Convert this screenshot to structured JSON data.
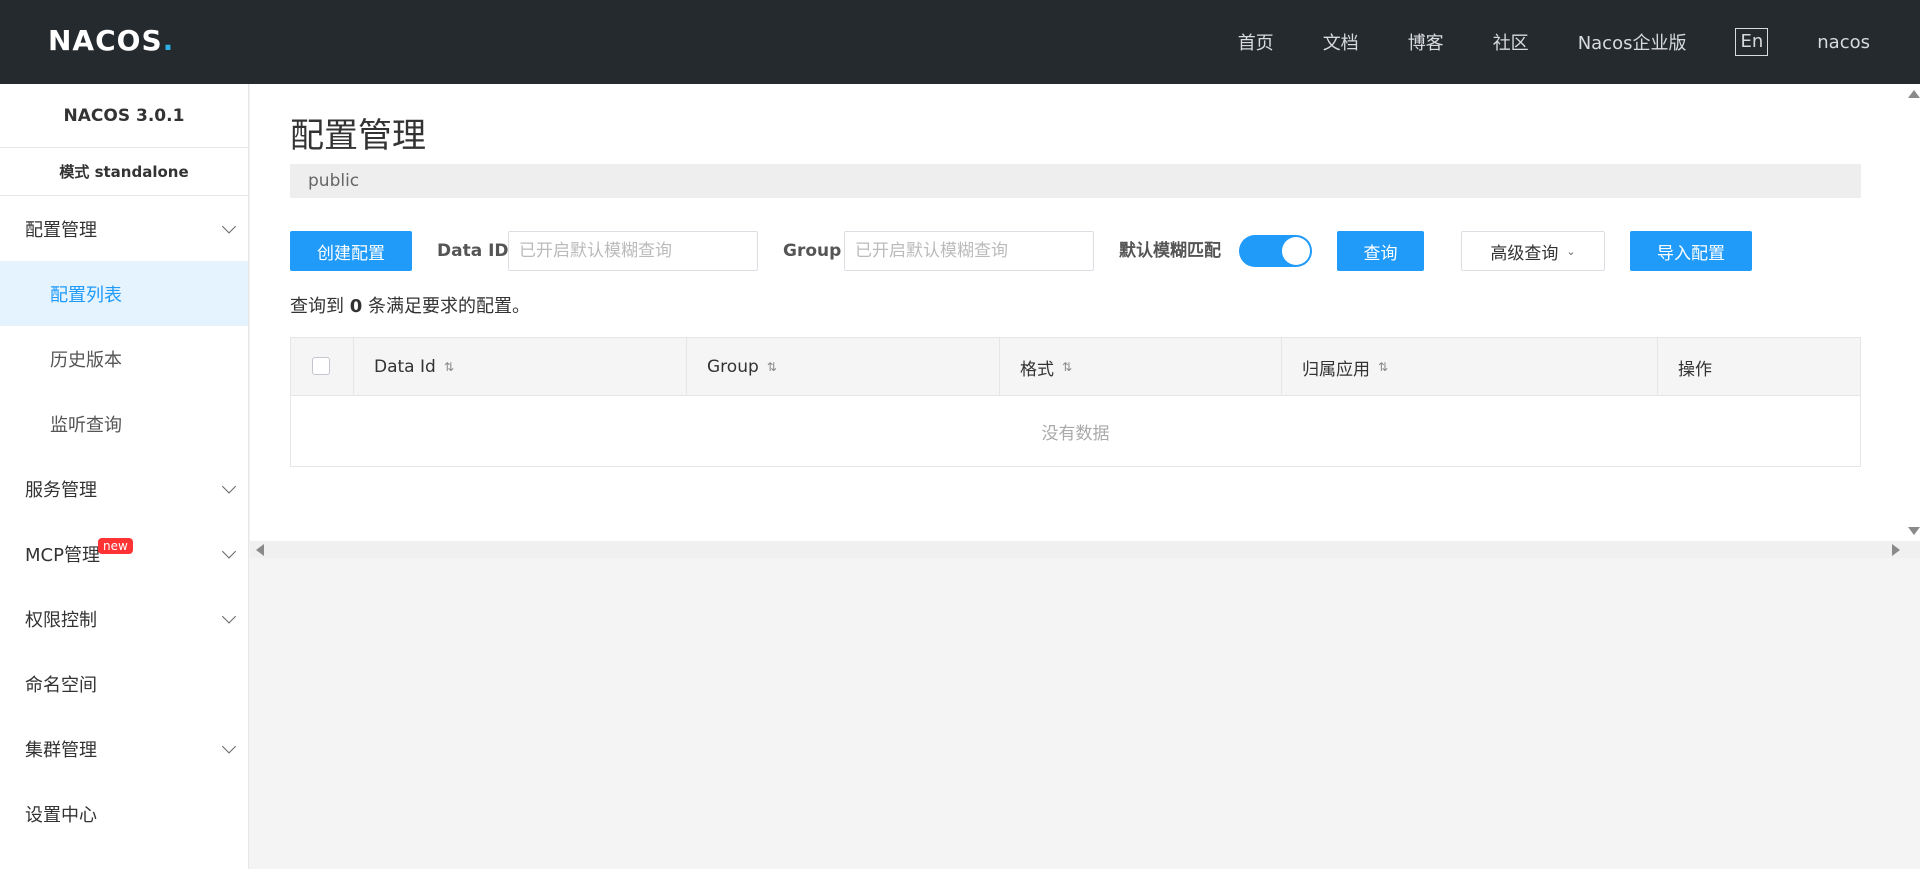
{
  "brand": {
    "logo_text": "NACOS",
    "logo_dot": "."
  },
  "topnav": {
    "items": [
      "首页",
      "文档",
      "博客",
      "社区",
      "Nacos企业版"
    ],
    "lang": "En",
    "user": "nacos"
  },
  "sidebar": {
    "version": "NACOS 3.0.1",
    "mode": "模式 standalone",
    "menu": [
      {
        "label": "配置管理",
        "expandable": true
      },
      {
        "label": "配置列表",
        "sub": true,
        "active": true
      },
      {
        "label": "历史版本",
        "sub": true
      },
      {
        "label": "监听查询",
        "sub": true
      },
      {
        "label": "服务管理",
        "expandable": true
      },
      {
        "label": "MCP管理",
        "expandable": true,
        "badge": "new"
      },
      {
        "label": "权限控制",
        "expandable": true
      },
      {
        "label": "命名空间"
      },
      {
        "label": "集群管理",
        "expandable": true
      },
      {
        "label": "设置中心"
      }
    ]
  },
  "main": {
    "title": "配置管理",
    "namespace": "public",
    "toolbar": {
      "create_label": "创建配置",
      "dataid_label": "Data ID",
      "dataid_placeholder": "已开启默认模糊查询",
      "group_label": "Group",
      "group_placeholder": "已开启默认模糊查询",
      "fuzzy_label": "默认模糊匹配",
      "fuzzy_on": true,
      "query_label": "查询",
      "advanced_label": "高级查询",
      "import_label": "导入配置"
    },
    "result": {
      "prefix": "查询到",
      "count": "0",
      "suffix": "条满足要求的配置。"
    },
    "table": {
      "columns": [
        "Data Id",
        "Group",
        "格式",
        "归属应用",
        "操作"
      ],
      "empty_text": "没有数据"
    }
  },
  "colors": {
    "primary": "#209bfa",
    "topbar": "#252a2f",
    "badge": "#ff3333"
  }
}
